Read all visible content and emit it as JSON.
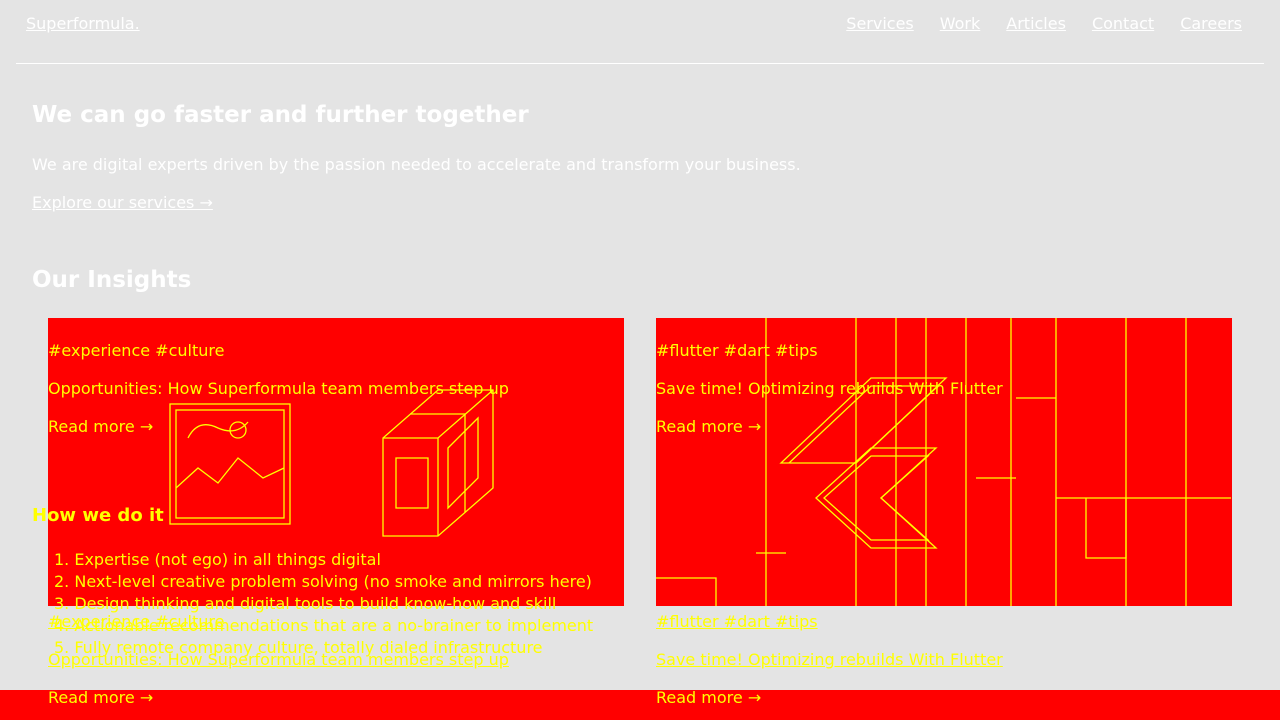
{
  "header": {
    "brand": "Superformula.",
    "nav": [
      "Services",
      "Work",
      "Articles",
      "Contact",
      "Careers"
    ]
  },
  "hero": {
    "title": "We can go faster and further together",
    "subtitle": "We are digital experts driven by the passion needed to accelerate and transform your business.",
    "cta": "Explore our services →"
  },
  "insights": {
    "title": "Our Insights",
    "cards": [
      {
        "tags": "#experience #culture",
        "title": "Opportunities: How Superformula team members step up",
        "read_more": "Read more →",
        "image": "people-boxes-illustration"
      },
      {
        "tags": "#flutter #dart #tips",
        "title": "Save time! Optimizing rebuilds With Flutter",
        "read_more": "Read more →",
        "image": "flutter-logo-illustration"
      }
    ]
  },
  "how": {
    "title": "How we do it",
    "items": [
      "1. Expertise (not ego) in all things digital",
      "2. Next-level creative problem solving (no smoke and mirrors here)",
      "3. Design thinking and digital tools to build know-how and skill",
      "4. Actionable recommendations that are a no-brainer to implement",
      "5. Fully remote company culture, totally dialed infrastructure"
    ]
  },
  "colors": {
    "background": "#e4e4e4",
    "card_fill": "#ff0000",
    "overlay_text": "#ffff00",
    "text": "#ffffff"
  }
}
